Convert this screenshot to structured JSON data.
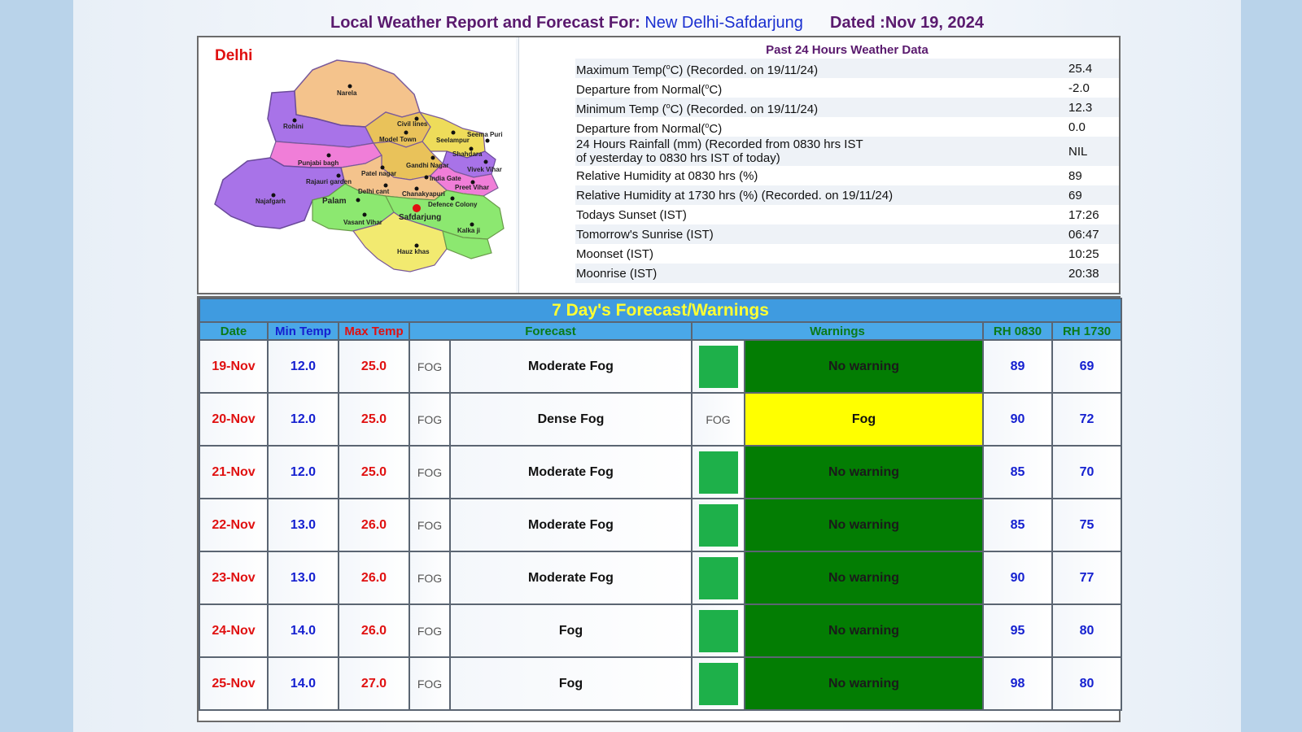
{
  "header": {
    "prefix": "Local Weather Report and Forecast For:",
    "station": "New Delhi-Safdarjung",
    "dated": "Dated :Nov 19, 2024"
  },
  "map": {
    "title": "Delhi",
    "districts": [
      "Narela",
      "Rohini",
      "Civil lines",
      "Model Town",
      "Seelampur",
      "Seema Puri",
      "Shahdara",
      "Punjabi bagh",
      "Patel nagar",
      "Gandhi Nagar",
      "Vivek Vihar",
      "Rajauri garden",
      "India Gate",
      "Preet Vihar",
      "Delhi cant",
      "Chanakyapuri",
      "Najafgarh",
      "Palam",
      "Defence Colony",
      "Safdarjung",
      "Vasant Vihar",
      "Kalka ji",
      "Hauz khas"
    ]
  },
  "past24": {
    "heading": "Past 24 Hours Weather Data",
    "rows": [
      {
        "label": "Maximum Temp(°C) (Recorded. on 19/11/24)",
        "value": "25.4"
      },
      {
        "label": "Departure from Normal(°C)",
        "value": "-2.0"
      },
      {
        "label": "Minimum Temp (°C) (Recorded. on 19/11/24)",
        "value": "12.3"
      },
      {
        "label": "Departure from Normal(°C)",
        "value": "0.0"
      },
      {
        "label": "24 Hours Rainfall (mm) (Recorded from 0830 hrs IST",
        "label2": "of yesterday to 0830 hrs IST of today)",
        "value": "NIL"
      },
      {
        "label": "Relative Humidity at 0830 hrs (%)",
        "value": "89"
      },
      {
        "label": "Relative Humidity at 1730 hrs (%) (Recorded. on 19/11/24)",
        "value": "69"
      },
      {
        "label": "Todays Sunset (IST)",
        "value": "17:26"
      },
      {
        "label": "Tomorrow's Sunrise (IST)",
        "value": "06:47"
      },
      {
        "label": "Moonset (IST)",
        "value": "10:25"
      },
      {
        "label": "Moonrise (IST)",
        "value": "20:38"
      }
    ]
  },
  "forecast": {
    "title": "7 Day's Forecast/Warnings",
    "headers": {
      "date": "Date",
      "min": "Min Temp",
      "max": "Max Temp",
      "forecast": "Forecast",
      "warnings": "Warnings",
      "rh0830": "RH 0830",
      "rh1730": "RH 1730"
    },
    "colors": {
      "no_warning": "#037d03",
      "fog_warning": "#ffff00",
      "swatch": "#1eb04a"
    },
    "rows": [
      {
        "date": "19-Nov",
        "min": "12.0",
        "max": "25.0",
        "code": "FOG",
        "forecast": "Moderate Fog",
        "wcode": "",
        "warning": "No warning",
        "level": "green",
        "rh0830": "89",
        "rh1730": "69"
      },
      {
        "date": "20-Nov",
        "min": "12.0",
        "max": "25.0",
        "code": "FOG",
        "forecast": "Dense Fog",
        "wcode": "FOG",
        "warning": "Fog",
        "level": "yellow",
        "rh0830": "90",
        "rh1730": "72"
      },
      {
        "date": "21-Nov",
        "min": "12.0",
        "max": "25.0",
        "code": "FOG",
        "forecast": "Moderate Fog",
        "wcode": "",
        "warning": "No warning",
        "level": "green",
        "rh0830": "85",
        "rh1730": "70"
      },
      {
        "date": "22-Nov",
        "min": "13.0",
        "max": "26.0",
        "code": "FOG",
        "forecast": "Moderate Fog",
        "wcode": "",
        "warning": "No warning",
        "level": "green",
        "rh0830": "85",
        "rh1730": "75"
      },
      {
        "date": "23-Nov",
        "min": "13.0",
        "max": "26.0",
        "code": "FOG",
        "forecast": "Moderate Fog",
        "wcode": "",
        "warning": "No warning",
        "level": "green",
        "rh0830": "90",
        "rh1730": "77"
      },
      {
        "date": "24-Nov",
        "min": "14.0",
        "max": "26.0",
        "code": "FOG",
        "forecast": "Fog",
        "wcode": "",
        "warning": "No warning",
        "level": "green",
        "rh0830": "95",
        "rh1730": "80"
      },
      {
        "date": "25-Nov",
        "min": "14.0",
        "max": "27.0",
        "code": "FOG",
        "forecast": "Fog",
        "wcode": "",
        "warning": "No warning",
        "level": "green",
        "rh0830": "98",
        "rh1730": "80"
      }
    ]
  }
}
